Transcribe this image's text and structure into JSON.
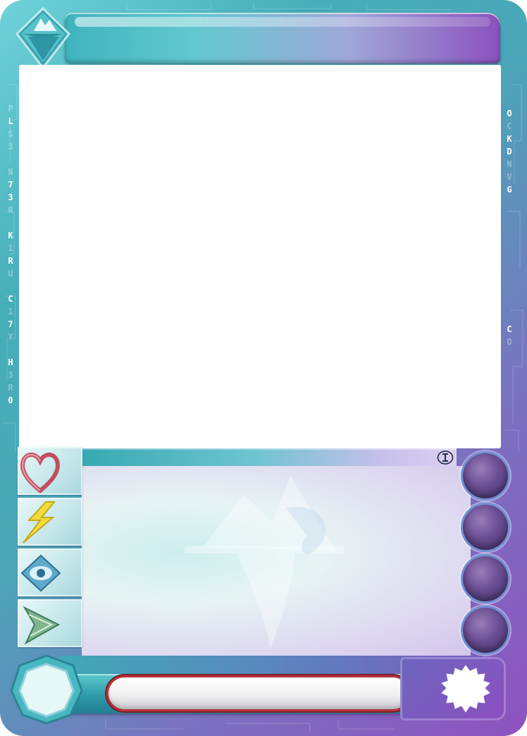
{
  "card": {
    "title": "",
    "theme_colors": {
      "teal": "#46aeb8",
      "purple": "#8d52bf",
      "art_window": "#ffffff"
    },
    "logo_icon": "iceberg-crystal-icon",
    "left_code": [
      "P",
      "L",
      "S",
      "3",
      "N",
      "7",
      "3",
      "R",
      "K",
      "1",
      "R",
      "U",
      "C",
      "1",
      "7",
      "Y",
      "H",
      "3",
      "R",
      "0"
    ],
    "right_code": [
      "O",
      "C",
      "K",
      "D",
      "N",
      "V",
      "G",
      "C",
      "O"
    ],
    "type_icon": "info-i-icon",
    "text_watermark_icon": "iceberg-watermark-icon",
    "stats": [
      {
        "icon": "heart-icon",
        "value": ""
      },
      {
        "icon": "lightning-icon",
        "value": ""
      },
      {
        "icon": "eye-icon",
        "value": ""
      },
      {
        "icon": "speed-arrow-icon",
        "value": ""
      }
    ],
    "element_orbs": [
      "fire-orb-icon",
      "fire-orb-icon",
      "leaf-orb-icon",
      "swirl-orb-icon"
    ],
    "footer": {
      "level_icon": "octagon-gem-icon",
      "name": "",
      "burst_icon": "starburst-icon"
    }
  }
}
